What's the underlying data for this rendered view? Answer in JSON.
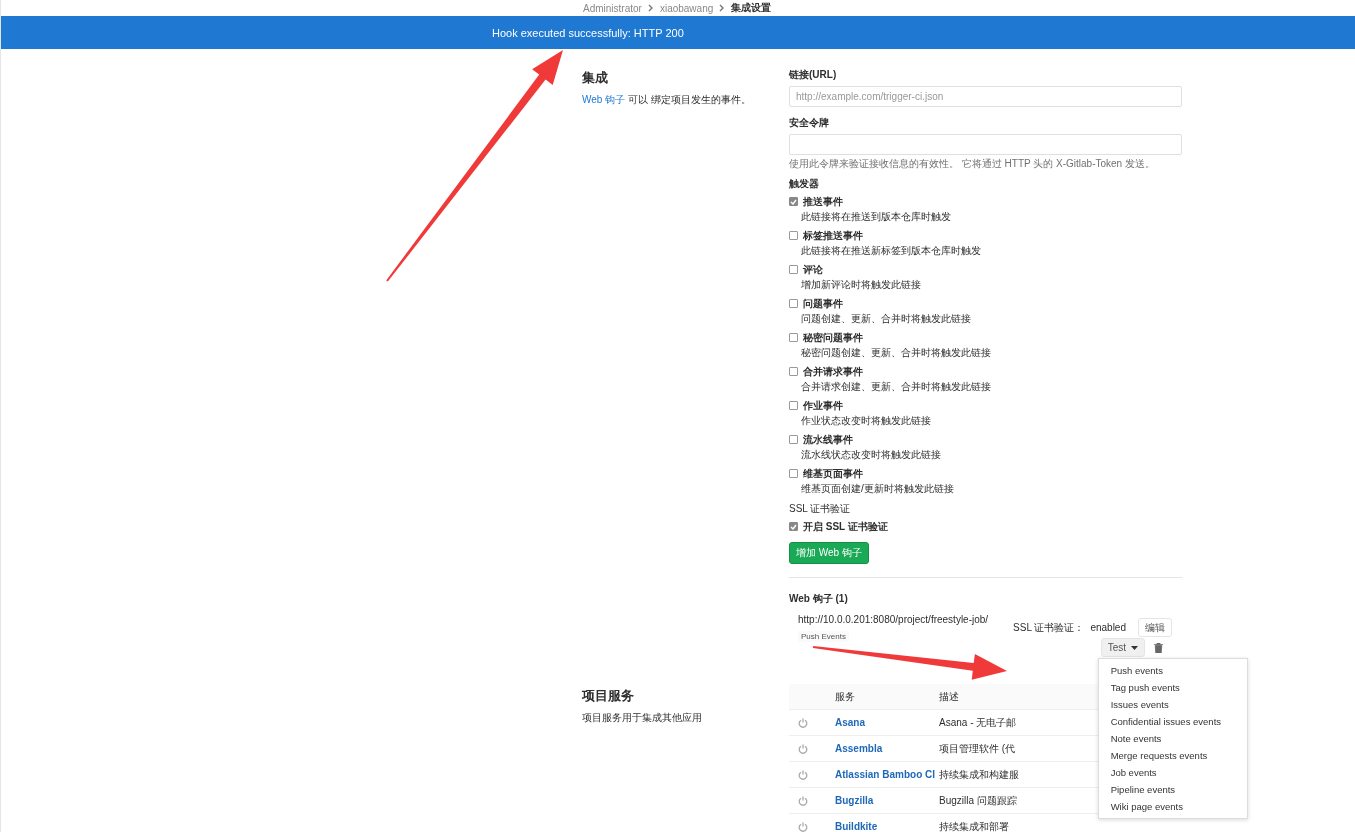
{
  "breadcrumb": [
    {
      "label": "Administrator",
      "current": false
    },
    {
      "label": "xiaobawang",
      "current": false
    },
    {
      "label": "集成设置",
      "current": true
    }
  ],
  "flash": {
    "message": "Hook executed successfully: HTTP 200"
  },
  "integrations": {
    "title": "集成",
    "link": "Web 钩子",
    "description": "可以 绑定项目发生的事件。"
  },
  "form": {
    "url_label": "链接(URL)",
    "url_placeholder": "http://example.com/trigger-ci.json",
    "token_label": "安全令牌",
    "token_help": "使用此令牌来验证接收信息的有效性。 它将通过 HTTP 头的 X-Gitlab-Token 发送。",
    "triggers_label": "触发器",
    "triggers": [
      {
        "label": "推送事件",
        "description": "此链接将在推送到版本仓库时触发",
        "checked": true
      },
      {
        "label": "标签推送事件",
        "description": "此链接将在推送新标签到版本仓库时触发",
        "checked": false
      },
      {
        "label": "评论",
        "description": "增加新评论时将触发此链接",
        "checked": false
      },
      {
        "label": "问题事件",
        "description": "问题创建、更新、合并时将触发此链接",
        "checked": false
      },
      {
        "label": "秘密问题事件",
        "description": "秘密问题创建、更新、合并时将触发此链接",
        "checked": false
      },
      {
        "label": "合并请求事件",
        "description": "合并请求创建、更新、合并时将触发此链接",
        "checked": false
      },
      {
        "label": "作业事件",
        "description": "作业状态改变时将触发此链接",
        "checked": false
      },
      {
        "label": "流水线事件",
        "description": "流水线状态改变时将触发此链接",
        "checked": false
      },
      {
        "label": "维基页面事件",
        "description": "维基页面创建/更新时将触发此链接",
        "checked": false
      }
    ],
    "ssl_label": "SSL 证书验证",
    "ssl_option": "开启 SSL 证书验证",
    "ssl_checked": true,
    "submit": "增加 Web 钩子"
  },
  "webhooks": {
    "title": "Web 钩子 (1)",
    "items": [
      {
        "url": "http://10.0.0.201:8080/project/freestyle-job/",
        "events": [
          "Push Events"
        ],
        "ssl_label": "SSL 证书验证：",
        "ssl_value": "enabled",
        "edit": "编辑",
        "test": "Test"
      }
    ]
  },
  "test_menu": {
    "items": [
      "Push events",
      "Tag push events",
      "Issues events",
      "Confidential issues events",
      "Note events",
      "Merge requests events",
      "Job events",
      "Pipeline events",
      "Wiki page events"
    ]
  },
  "services": {
    "title": "项目服务",
    "description": "项目服务用于集成其他应用",
    "columns": [
      "服务",
      "描述"
    ],
    "rows": [
      {
        "name": "Asana",
        "description": "Asana - 无电子邮"
      },
      {
        "name": "Assembla",
        "description": "项目管理软件 (代"
      },
      {
        "name": "Atlassian Bamboo CI",
        "description": "持续集成和构建服"
      },
      {
        "name": "Bugzilla",
        "description": "Bugzilla 问题跟踪"
      },
      {
        "name": "Buildkite",
        "description": "持续集成和部署"
      }
    ]
  }
}
